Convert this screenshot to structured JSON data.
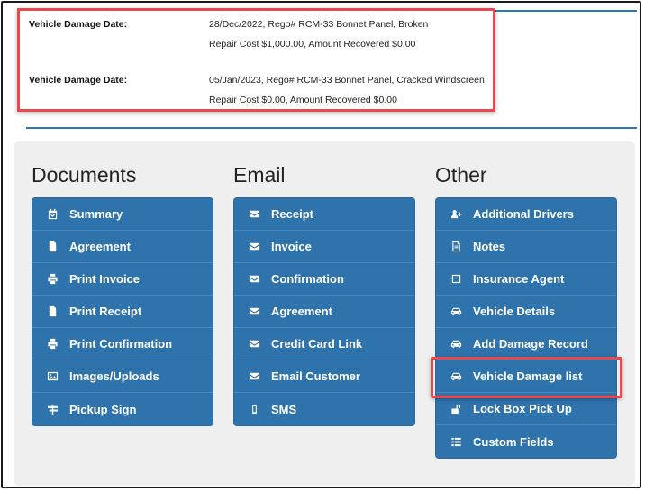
{
  "damage_records": [
    {
      "label": "Vehicle Damage Date:",
      "line1": "28/Dec/2022, Rego#  RCM-33  Bonnet Panel, Broken",
      "line2": "Repair Cost $1,000.00, Amount Recovered $0.00"
    },
    {
      "label": "Vehicle Damage Date:",
      "line1": "05/Jan/2023, Rego# RCM-33 Bonnet Panel, Cracked Windscreen",
      "line2": "Repair Cost $0.00, Amount Recovered $0.00"
    }
  ],
  "columns": {
    "documents": {
      "title": "Documents",
      "items": [
        {
          "label": "Summary",
          "icon": "calendar-check-icon"
        },
        {
          "label": "Agreement",
          "icon": "file-icon"
        },
        {
          "label": "Print Invoice",
          "icon": "printer-icon"
        },
        {
          "label": "Print Receipt",
          "icon": "file-icon"
        },
        {
          "label": "Print Confirmation",
          "icon": "printer-icon"
        },
        {
          "label": "Images/Uploads",
          "icon": "image-icon"
        },
        {
          "label": "Pickup Sign",
          "icon": "signpost-icon"
        }
      ]
    },
    "email": {
      "title": "Email",
      "items": [
        {
          "label": "Receipt",
          "icon": "envelope-icon"
        },
        {
          "label": "Invoice",
          "icon": "envelope-icon"
        },
        {
          "label": "Confirmation",
          "icon": "envelope-icon"
        },
        {
          "label": "Agreement",
          "icon": "envelope-icon"
        },
        {
          "label": "Credit Card Link",
          "icon": "envelope-icon"
        },
        {
          "label": "Email Customer",
          "icon": "envelope-icon"
        },
        {
          "label": "SMS",
          "icon": "mobile-icon"
        }
      ]
    },
    "other": {
      "title": "Other",
      "items": [
        {
          "label": "Additional Drivers",
          "icon": "user-plus-icon"
        },
        {
          "label": "Notes",
          "icon": "document-text-icon"
        },
        {
          "label": "Insurance Agent",
          "icon": "square-icon"
        },
        {
          "label": "Vehicle Details",
          "icon": "car-icon"
        },
        {
          "label": "Add Damage Record",
          "icon": "car-icon"
        },
        {
          "label": "Vehicle Damage list",
          "icon": "car-icon"
        },
        {
          "label": "Lock Box Pick Up",
          "icon": "unlock-icon"
        },
        {
          "label": "Custom Fields",
          "icon": "list-icon"
        }
      ]
    }
  },
  "colors": {
    "button_blue": "#2f73ad",
    "highlight_red": "#e8494e",
    "rule_blue": "#2a7ab8",
    "panel_bg": "#efefef"
  }
}
